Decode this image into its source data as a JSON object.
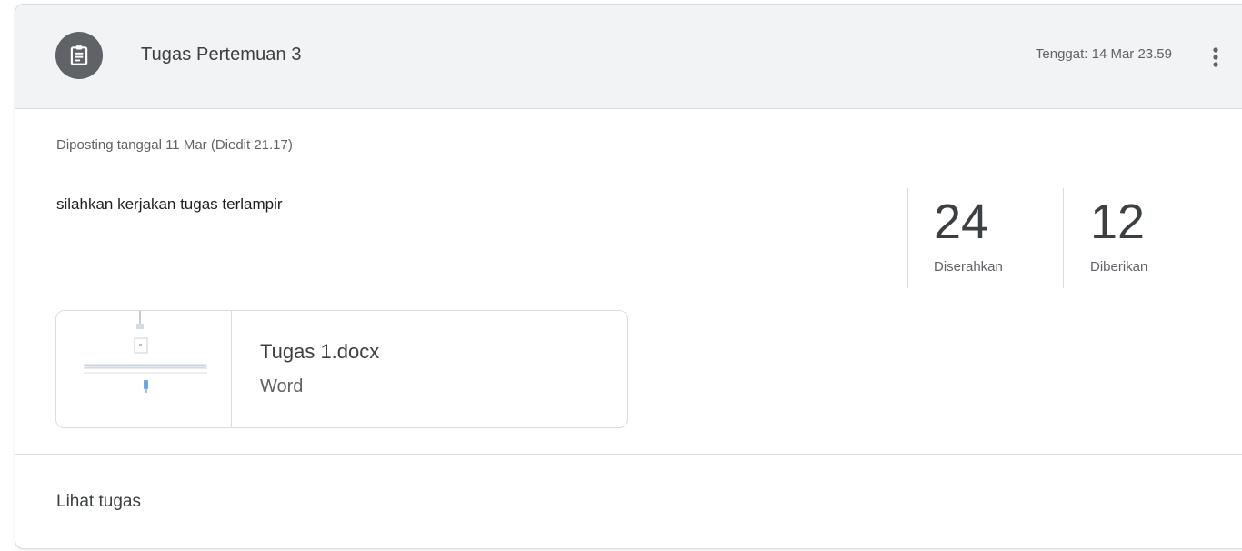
{
  "header": {
    "title": "Tugas Pertemuan 3",
    "due": "Tenggat: 14 Mar 23.59",
    "icon": "assignment-icon",
    "more_icon": "more-vert-icon"
  },
  "body": {
    "posted": "Diposting tanggal 11 Mar (Diedit 21.17)",
    "instructions": "silahkan kerjakan tugas terlampir"
  },
  "stats": [
    {
      "count": "24",
      "label": "Diserahkan"
    },
    {
      "count": "12",
      "label": "Diberikan"
    }
  ],
  "attachment": {
    "name": "Tugas 1.docx",
    "type": "Word",
    "thumbnail_icon": "document-thumbnail"
  },
  "footer": {
    "link": "Lihat tugas"
  },
  "colors": {
    "header_bg": "#f1f3f4",
    "avatar_bg": "#5f6368",
    "border": "#dadce0"
  }
}
